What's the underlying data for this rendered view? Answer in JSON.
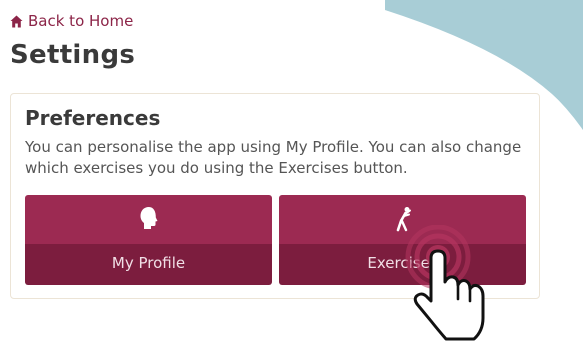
{
  "nav": {
    "back_label": "Back to Home",
    "back_icon": "home-icon"
  },
  "page": {
    "title": "Settings"
  },
  "preferences": {
    "heading": "Preferences",
    "description": "You can personalise the app using My Profile. You can also change which exercises you do using the Exercises button.",
    "buttons": [
      {
        "label": "My Profile",
        "icon": "head-silhouette-icon"
      },
      {
        "label": "Exercises",
        "icon": "stretching-figure-icon"
      }
    ]
  },
  "colors": {
    "accent": "#8c2548",
    "tile_top": "#9c2a52",
    "tile_bottom": "#7c1d3e",
    "background_blob": "#a8cdd6",
    "tap_overlay": "#b5355f"
  },
  "overlay": {
    "icon": "tap-hand-icon"
  }
}
